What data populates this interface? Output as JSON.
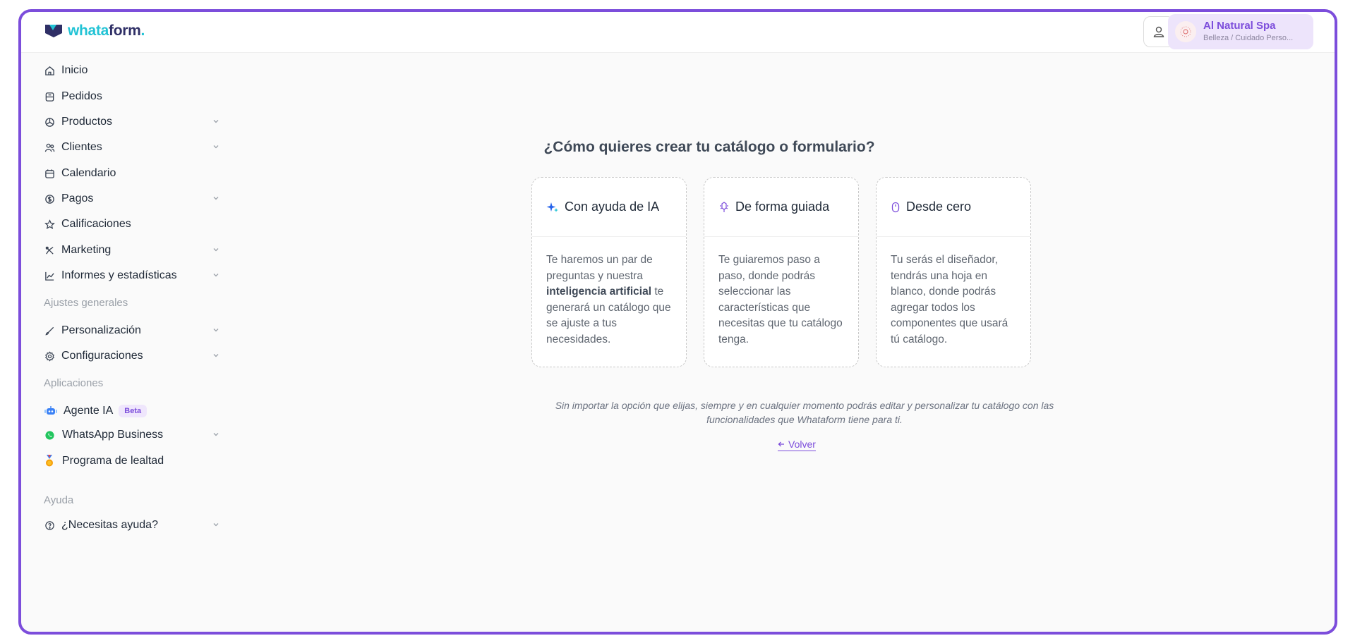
{
  "brand": {
    "logo_part1": "whata",
    "logo_part2": "form",
    "logo_dot": "."
  },
  "account": {
    "name": "Al Natural Spa",
    "category": "Belleza / Cuidado Perso..."
  },
  "sidebar": {
    "items": [
      {
        "label": "Inicio",
        "icon": "home-icon"
      },
      {
        "label": "Pedidos",
        "icon": "orders-icon"
      },
      {
        "label": "Productos",
        "icon": "products-icon"
      },
      {
        "label": "Clientes",
        "icon": "clients-icon"
      },
      {
        "label": "Calendario",
        "icon": "calendar-icon"
      },
      {
        "label": "Pagos",
        "icon": "payments-icon"
      },
      {
        "label": "Calificaciones",
        "icon": "star-icon"
      },
      {
        "label": "Marketing",
        "icon": "marketing-icon"
      },
      {
        "label": "Informes y estadísticas",
        "icon": "chart-icon"
      }
    ],
    "section_general": "Ajustes generales",
    "general_items": [
      {
        "label": "Personalización",
        "icon": "brush-icon"
      },
      {
        "label": "Configuraciones",
        "icon": "settings-icon"
      }
    ],
    "section_apps": "Aplicaciones",
    "app_items": [
      {
        "label": "Agente IA",
        "badge": "Beta",
        "icon": "robot-icon"
      },
      {
        "label": "WhatsApp Business",
        "icon": "whatsapp-icon"
      },
      {
        "label": "Programa de lealtad",
        "icon": "medal-icon"
      }
    ],
    "section_help": "Ayuda",
    "help_items": [
      {
        "label": "¿Necesitas ayuda?",
        "icon": "help-icon"
      }
    ]
  },
  "main": {
    "title": "¿Cómo quieres crear tu catálogo o formulario?",
    "cards": [
      {
        "title": "Con ayuda de IA",
        "body_before": "Te haremos un par de preguntas y nuestra ",
        "body_bold": "inteligencia artificial",
        "body_after": " te generará un catálogo que se ajuste a tus necesidades."
      },
      {
        "title": "De forma guiada",
        "body": "Te guiaremos paso a paso, donde podrás seleccionar las características que necesitas que tu catálogo tenga."
      },
      {
        "title": "Desde cero",
        "body": "Tu serás el diseñador, tendrás una hoja en blanco, donde podrás agregar todos los componentes que usará tú catálogo."
      }
    ],
    "note": "Sin importar la opción que elijas, siempre y en cualquier momento podrás editar y personalizar tu catálogo con las funcionalidades que Whataform tiene para ti.",
    "back_label": "Volver"
  },
  "colors": {
    "accent": "#7c4ddb",
    "brand_cyan": "#22c3d5",
    "brand_navy": "#2f2f66"
  }
}
